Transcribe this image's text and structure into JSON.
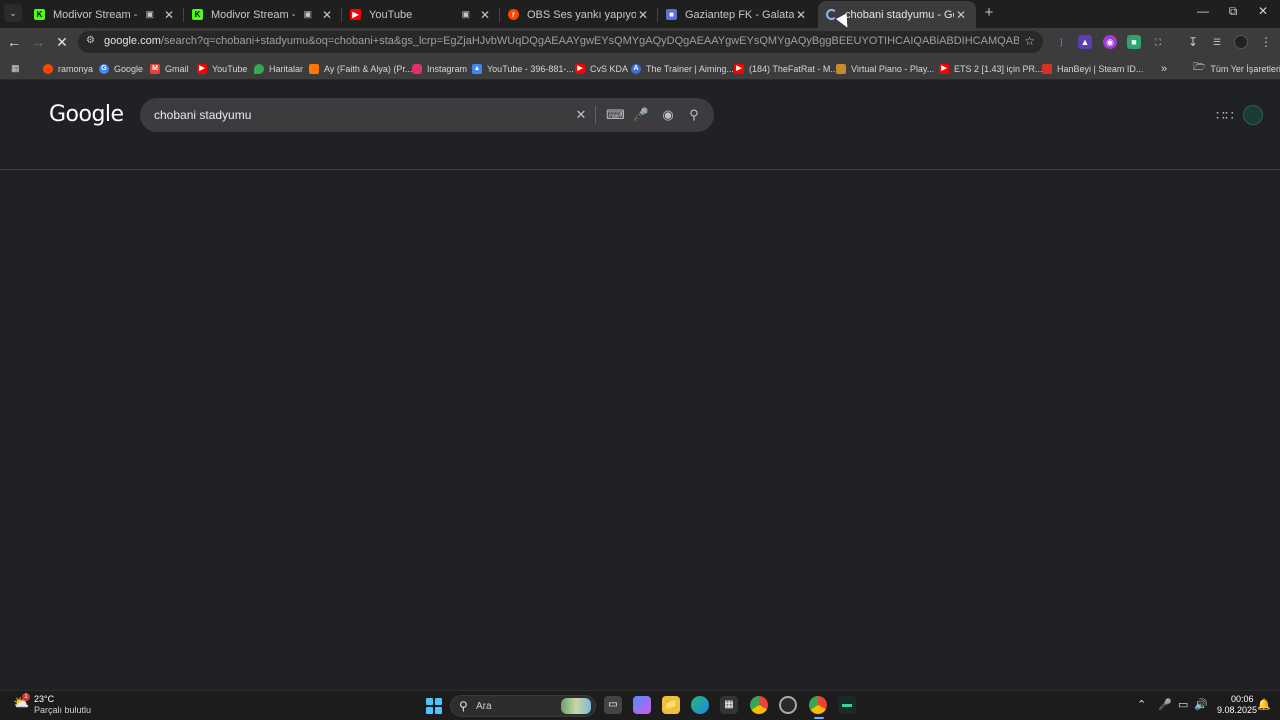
{
  "browser": {
    "tabs": [
      {
        "title": "Modivor Stream - Watch Li",
        "favicon": "kick-icon",
        "media": true
      },
      {
        "title": "Modivor Stream - Kick Das",
        "favicon": "kick-icon",
        "media": true
      },
      {
        "title": "YouTube",
        "favicon": "youtube-icon",
        "media": true
      },
      {
        "title": "OBS Ses yankı yapıyor, ÇÖZÜLD",
        "favicon": "reddit-icon",
        "media": false
      },
      {
        "title": "Gaziantep FK - Galatasaray canl",
        "favicon": "stream-icon",
        "media": false
      },
      {
        "title": "chobani stadyumu - Google'da A",
        "favicon": "loading-icon",
        "media": false
      }
    ],
    "toolbar": {
      "url_host": "google.com",
      "url_rest": "/search?q=chobani+stadyumu&oq=chobani+sta&gs_lcrp=EgZjaHJvbWUqDQgAEAAYgwEYsQMYgAQyDQgAEAAYgwEYsQMYgAQyBggBEEUYOTIHCAIQABiABDIHCAMQABiABDIHCAQQABiABDIHCAUQABiABDI..."
    },
    "bookmarks": [
      {
        "label": "ramonya",
        "color": "#ff4500"
      },
      {
        "label": "Google",
        "color": "#4285f4"
      },
      {
        "label": "Gmail",
        "color": "#ea4335"
      },
      {
        "label": "YouTube",
        "color": "#ff0000"
      },
      {
        "label": "Haritalar",
        "color": "#34a853"
      },
      {
        "label": "Ay (Faith & Alya) (Pr...",
        "color": "#ff7700"
      },
      {
        "label": "Instagram",
        "color": "#e1306c"
      },
      {
        "label": "YouTube - 396-881-...",
        "color": "#4285f4"
      },
      {
        "label": "CvS KDA",
        "color": "#ff0000"
      },
      {
        "label": "The Trainer | Aiming...",
        "color": "#3a6fd8"
      },
      {
        "label": "(184) TheFatRat - M...",
        "color": "#ff0000"
      },
      {
        "label": "Virtual Piano - Play...",
        "color": "#c98a2b"
      },
      {
        "label": "ETS 2 [1.43] için PR...",
        "color": "#ff0000"
      },
      {
        "label": "HanBeyi | Steam ID...",
        "color": "#d93025"
      }
    ],
    "all_bookmarks_label": "Tüm Yer İşaretleri"
  },
  "google": {
    "logo": "Google",
    "query": "chobani stadyumu"
  },
  "taskbar": {
    "weather_temp": "23°C",
    "weather_desc": "Parçalı bulutlu",
    "weather_badge": "1",
    "search_placeholder": "Ara",
    "time": "00:06",
    "date": "9.08.2025"
  }
}
